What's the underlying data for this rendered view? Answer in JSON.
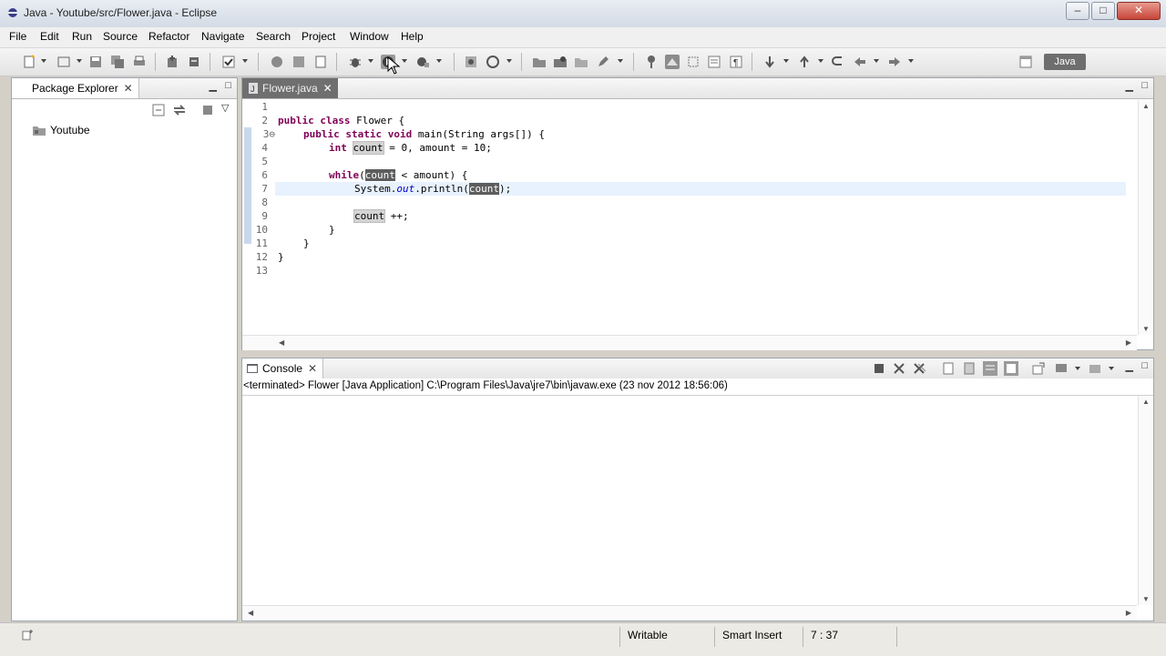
{
  "window": {
    "title": "Java - Youtube/src/Flower.java - Eclipse",
    "minimize": "–",
    "maximize": "□",
    "close": "✕"
  },
  "menu": [
    "File",
    "Edit",
    "Run",
    "Source",
    "Refactor",
    "Navigate",
    "Search",
    "Project",
    "Window",
    "Help"
  ],
  "perspective": {
    "label": "Java"
  },
  "package_explorer": {
    "tab_label": "Package Explorer",
    "tree": [
      {
        "label": "Youtube"
      }
    ]
  },
  "editor": {
    "tab_label": "Flower.java",
    "line_numbers": [
      "1",
      "2",
      "3⊖",
      "4",
      "5",
      "6",
      "7",
      "8",
      "9",
      "10",
      "11",
      "12",
      "13"
    ],
    "lines": {
      "l2": {
        "k1": "public",
        "k2": "class",
        "rest": " Flower {"
      },
      "l3": {
        "k1": "public",
        "k2": "static",
        "k3": "void",
        "rest": " main(String args[]) {"
      },
      "l4": {
        "k1": "int",
        "occ": "count",
        "rest": " = 0, amount = 10;"
      },
      "l6": {
        "k1": "while",
        "p1": "(",
        "occ": "count",
        "rest": " < amount) {"
      },
      "l7": {
        "a": "System.",
        "it": "out",
        "b": ".println(",
        "occ": "count",
        "c": ");"
      },
      "l9": {
        "occ": "count",
        "rest": " ++;"
      },
      "l10": "}",
      "l11": "}",
      "l12": "}"
    }
  },
  "console": {
    "tab_label": "Console",
    "description": "<terminated> Flower [Java Application] C:\\Program Files\\Java\\jre7\\bin\\javaw.exe (23 nov 2012 18:56:06)"
  },
  "status": {
    "writable": "Writable",
    "insert_mode": "Smart Insert",
    "position": "7 : 37"
  },
  "colors": {
    "keyword": "#7f0055",
    "field": "#0000c0",
    "current_line": "#e8f2fe",
    "occurrence": "#d4d4d4"
  }
}
